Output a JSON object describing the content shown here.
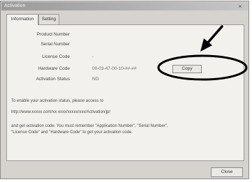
{
  "window": {
    "title": "Activation",
    "close_glyph": "×"
  },
  "tabs": [
    {
      "label": "Information"
    },
    {
      "label": "Setting"
    }
  ],
  "info": {
    "rows": [
      {
        "label": "Product Number",
        "value": ""
      },
      {
        "label": "Serial Number",
        "value": ""
      },
      {
        "label": "License Code",
        "value": "-"
      },
      {
        "label": "Hardware Code",
        "value": "00-03-47-00-10-##-##"
      },
      {
        "label": "Activation Status",
        "value": "NG"
      }
    ],
    "copy_label": "Copy"
  },
  "text": {
    "line1": "To enable your activation status, please access to",
    "url": "http://www.xxxxx.com/xx-xxxx/xxxxx/xxx/Activation/jp/",
    "line3": "and get activation code. You must remember \"Application Number\", \"Serial Number\",",
    "line4": "\"License Code\" and \"Hardware Code\" to get your activation code."
  },
  "footer": {
    "close_label": "Close"
  },
  "annotation": {
    "stroke_color": "#000000"
  }
}
